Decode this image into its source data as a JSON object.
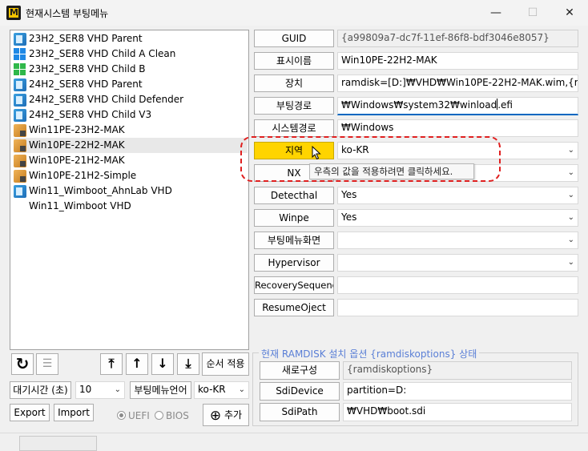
{
  "window": {
    "title": "현재시스템 부팅메뉴",
    "minimize": "—",
    "maximize": "☐",
    "close": "✕"
  },
  "entries": [
    {
      "label": "23H2_SER8 VHD Parent",
      "icon": "vhd-icon"
    },
    {
      "label": "23H2_SER8 VHD Child A Clean",
      "icon": "windows-blue-icon"
    },
    {
      "label": "23H2_SER8 VHD Child B",
      "icon": "windows-green-icon"
    },
    {
      "label": "24H2_SER8 VHD Parent",
      "icon": "vhd-icon"
    },
    {
      "label": "24H2_SER8 VHD Child Defender",
      "icon": "vhd-icon"
    },
    {
      "label": "24H2_SER8 VHD Child V3",
      "icon": "vhd-icon"
    },
    {
      "label": "Win11PE-23H2-MAK",
      "icon": "wim-icon"
    },
    {
      "label": "Win10PE-22H2-MAK",
      "icon": "wim-icon"
    },
    {
      "label": "Win10PE-21H2-MAK",
      "icon": "wim-icon"
    },
    {
      "label": "Win10PE-21H2-Simple",
      "icon": "wim-icon"
    },
    {
      "label": "Win11_Wimboot_AhnLab VHD",
      "icon": "vhd-icon"
    },
    {
      "label": "Win11_Wimboot VHD",
      "icon": ""
    }
  ],
  "properties": {
    "guid": {
      "label": "GUID",
      "value": "{a99809a7-dc7f-11ef-86f8-bdf3046e8057}"
    },
    "description": {
      "label": "표시이름",
      "value": "Win10PE-22H2-MAK"
    },
    "device": {
      "label": "장치",
      "value": "ramdisk=[D:]₩VHD₩Win10PE-22H2-MAK.wim,{ramdiskoptions}"
    },
    "path": {
      "label": "부팅경로",
      "value_before_caret": "₩Windows₩system32₩winload",
      "value_after_caret": ".efi"
    },
    "systemroot": {
      "label": "시스템경로",
      "value": "₩Windows"
    },
    "locale": {
      "label": "지역",
      "value": "ko-KR"
    },
    "nx": {
      "label": "NX",
      "value": ""
    },
    "detecthal": {
      "label": "Detecthal",
      "value": "Yes"
    },
    "winpe": {
      "label": "Winpe",
      "value": "Yes"
    },
    "bootmenupolicy": {
      "label": "부팅메뉴화면",
      "value": ""
    },
    "hypervisor": {
      "label": "Hypervisor",
      "value": ""
    },
    "recoverysequence": {
      "label": "RecoverySequenc",
      "value": ""
    },
    "resumeobject": {
      "label": "ResumeOject",
      "value": ""
    }
  },
  "tooltip": "우측의 값을 적용하려면 클릭하세요.",
  "ramdisk": {
    "group_title": "현재 RAMDISK 설치 옵션 {ramdiskoptions} 상태",
    "new_label": "새로구성",
    "new_value": "{ramdiskoptions}",
    "sdidevice_label": "SdiDevice",
    "sdidevice_value": "partition=D:",
    "sdipath_label": "SdiPath",
    "sdipath_value": "₩VHD₩boot.sdi"
  },
  "toolbar": {
    "refresh_icon": "↻",
    "list_icon": "☰",
    "move_top_icon": "⤒",
    "move_up_icon": "↑",
    "move_down_icon": "↓",
    "move_bottom_icon": "⤓",
    "apply_order": "순서 적용"
  },
  "timeout": {
    "label": "대기시간 (초)",
    "value": "10"
  },
  "bootmenu_language": {
    "label": "부팅메뉴언어",
    "value": "ko-KR"
  },
  "export_label": "Export",
  "import_label": "Import",
  "firmware": {
    "uefi": "UEFI",
    "bios": "BIOS"
  },
  "add_label": "추가",
  "add_icon": "⊕",
  "dropdown_icon": "⌄"
}
